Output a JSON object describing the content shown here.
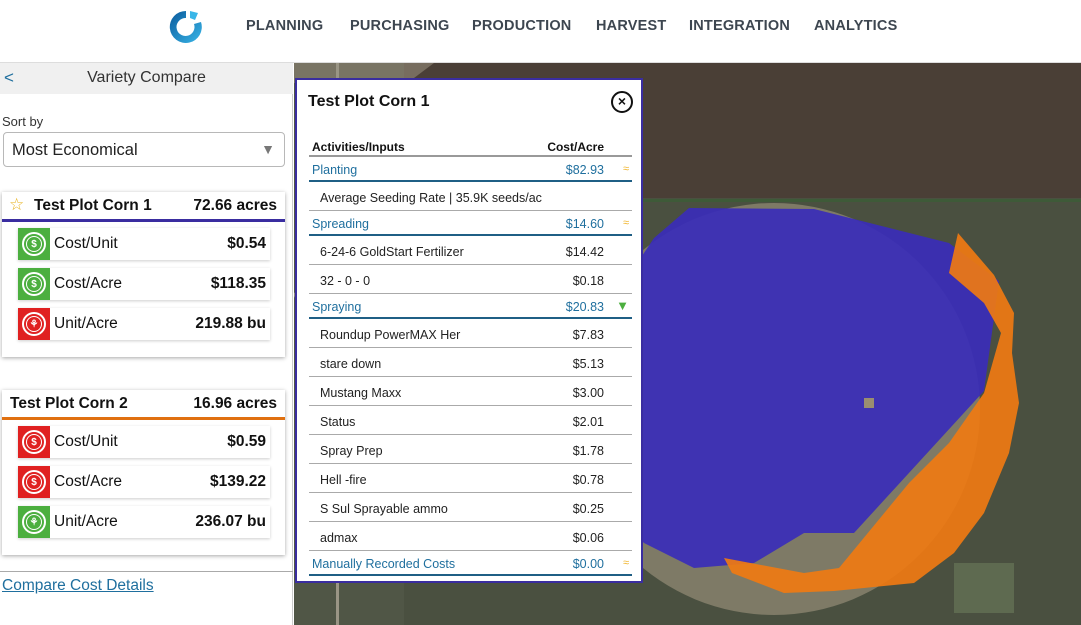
{
  "nav": {
    "logo": "app-logo",
    "items": [
      "PLANNING",
      "PURCHASING",
      "PRODUCTION",
      "HARVEST",
      "INTEGRATION",
      "ANALYTICS"
    ]
  },
  "sidebar": {
    "back_icon": "<",
    "title": "Variety Compare",
    "sort_label": "Sort by",
    "sort_value": "Most Economical",
    "sort_arrow": "▼",
    "cards": [
      {
        "name": "Test Plot Corn 1",
        "acres": "72.66 acres",
        "starred": true,
        "star_icon": "☆",
        "color": "#3a2da0",
        "metrics": [
          {
            "label": "Cost/Unit",
            "value": "$0.54",
            "icon": "dollar-icon",
            "status": "green"
          },
          {
            "label": "Cost/Acre",
            "value": "$118.35",
            "icon": "dollar-icon",
            "status": "green"
          },
          {
            "label": "Unit/Acre",
            "value": "219.88 bu",
            "icon": "wheat-icon",
            "status": "red"
          }
        ]
      },
      {
        "name": "Test Plot Corn 2",
        "acres": "16.96 acres",
        "starred": false,
        "color": "#e07010",
        "metrics": [
          {
            "label": "Cost/Unit",
            "value": "$0.59",
            "icon": "dollar-icon",
            "status": "red"
          },
          {
            "label": "Cost/Acre",
            "value": "$139.22",
            "icon": "dollar-icon",
            "status": "red"
          },
          {
            "label": "Unit/Acre",
            "value": "236.07 bu",
            "icon": "wheat-icon",
            "status": "green"
          }
        ]
      }
    ],
    "compare_link": "Compare Cost Details"
  },
  "popup": {
    "title": "Test Plot Corn 1",
    "close_icon": "×",
    "col_activity": "Activities/Inputs",
    "col_cost": "Cost/Acre",
    "rows": [
      {
        "type": "group",
        "name": "Planting",
        "cost": "$82.93",
        "indicator": "≈"
      },
      {
        "type": "item",
        "name": "Average Seeding Rate | 35.9K seeds/ac",
        "cost": ""
      },
      {
        "type": "group",
        "name": "Spreading",
        "cost": "$14.60",
        "indicator": "≈"
      },
      {
        "type": "item",
        "name": "6-24-6 GoldStart Fertilizer",
        "cost": "$14.42"
      },
      {
        "type": "item",
        "name": "32 - 0 - 0",
        "cost": "$0.18"
      },
      {
        "type": "group",
        "name": "Spraying",
        "cost": "$20.83",
        "indicator": "▼"
      },
      {
        "type": "item",
        "name": "Roundup PowerMAX Her",
        "cost": "$7.83"
      },
      {
        "type": "item",
        "name": "stare down",
        "cost": "$5.13"
      },
      {
        "type": "item",
        "name": "Mustang Maxx",
        "cost": "$3.00"
      },
      {
        "type": "item",
        "name": "Status",
        "cost": "$2.01"
      },
      {
        "type": "item",
        "name": "Spray Prep",
        "cost": "$1.78"
      },
      {
        "type": "item",
        "name": "Hell -fire",
        "cost": "$0.78"
      },
      {
        "type": "item",
        "name": "S Sul Sprayable ammo",
        "cost": "$0.25"
      },
      {
        "type": "item",
        "name": "admax",
        "cost": "$0.06"
      },
      {
        "type": "group",
        "name": "Manually Recorded Costs",
        "cost": "$0.00",
        "indicator": "≈"
      }
    ]
  },
  "map": {
    "zone_colors": {
      "corn1": "#3a2db8",
      "corn2": "#ef7a12"
    }
  }
}
